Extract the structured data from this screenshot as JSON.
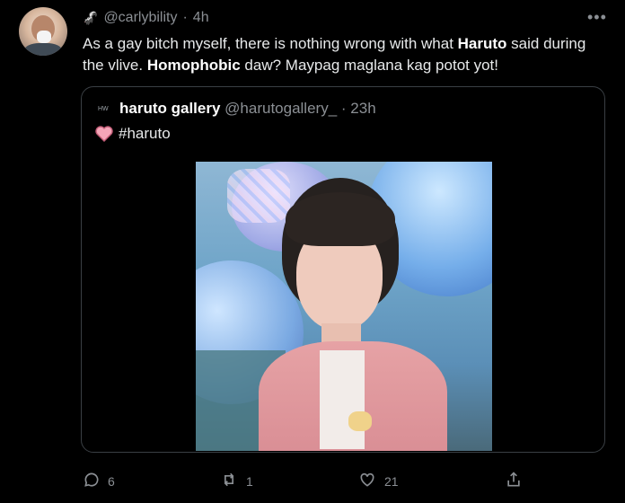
{
  "tweet": {
    "emoji": "🦨",
    "handle": "@carlybility",
    "time_sep": "·",
    "time": "4h",
    "text_parts": [
      {
        "t": "As a gay bitch myself, there is nothing wrong with what ",
        "b": false
      },
      {
        "t": "Haruto",
        "b": true
      },
      {
        "t": " said during the vlive. ",
        "b": false
      },
      {
        "t": "Homophobic",
        "b": true
      },
      {
        "t": " daw? Maypag maglana kag potot yot!",
        "b": false
      }
    ]
  },
  "quote": {
    "avatar_text": "HW",
    "name": "haruto gallery",
    "handle": "@harutogallery_",
    "time_sep": "·",
    "time": "23h",
    "hashtag": "#haruto"
  },
  "actions": {
    "replies": "6",
    "retweets": "1",
    "likes": "21"
  },
  "icons": {
    "more": "more-horizontal-icon",
    "reply": "reply-icon",
    "retweet": "retweet-icon",
    "like": "like-icon",
    "share": "share-icon",
    "heart_emoji": "heart-emoji-icon"
  },
  "colors": {
    "background": "#000000",
    "text": "#e7e9ea",
    "muted": "#8b8f94",
    "border": "#3a3f44",
    "heart": "#f4a6b8"
  }
}
